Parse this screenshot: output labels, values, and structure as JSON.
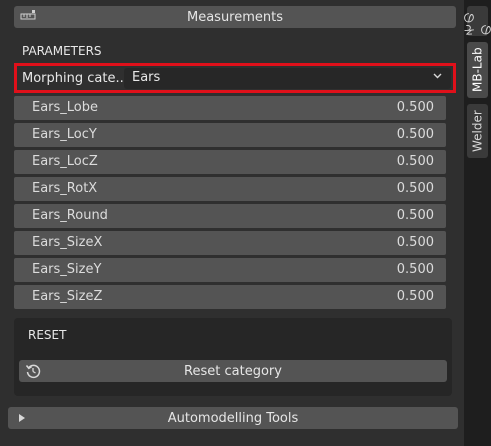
{
  "header": {
    "measurements_label": "Measurements"
  },
  "parameters": {
    "title": "PARAMETERS"
  },
  "morphing": {
    "label": "Morphing cate..",
    "selected": "Ears"
  },
  "sliders": [
    {
      "name": "Ears_Lobe",
      "value": "0.500"
    },
    {
      "name": "Ears_LocY",
      "value": "0.500"
    },
    {
      "name": "Ears_LocZ",
      "value": "0.500"
    },
    {
      "name": "Ears_RotX",
      "value": "0.500"
    },
    {
      "name": "Ears_Round",
      "value": "0.500"
    },
    {
      "name": "Ears_SizeX",
      "value": "0.500"
    },
    {
      "name": "Ears_SizeY",
      "value": "0.500"
    },
    {
      "name": "Ears_SizeZ",
      "value": "0.500"
    }
  ],
  "reset": {
    "title": "RESET",
    "button_label": "Reset category"
  },
  "footer": {
    "automodelling_label": "Automodelling Tools"
  },
  "sidebar": {
    "tabs": [
      "そのの",
      "MB-Lab",
      "Welder"
    ]
  },
  "colors": {
    "highlight": "#e0101a",
    "button": "#545454",
    "panel": "#2f2f2f"
  }
}
